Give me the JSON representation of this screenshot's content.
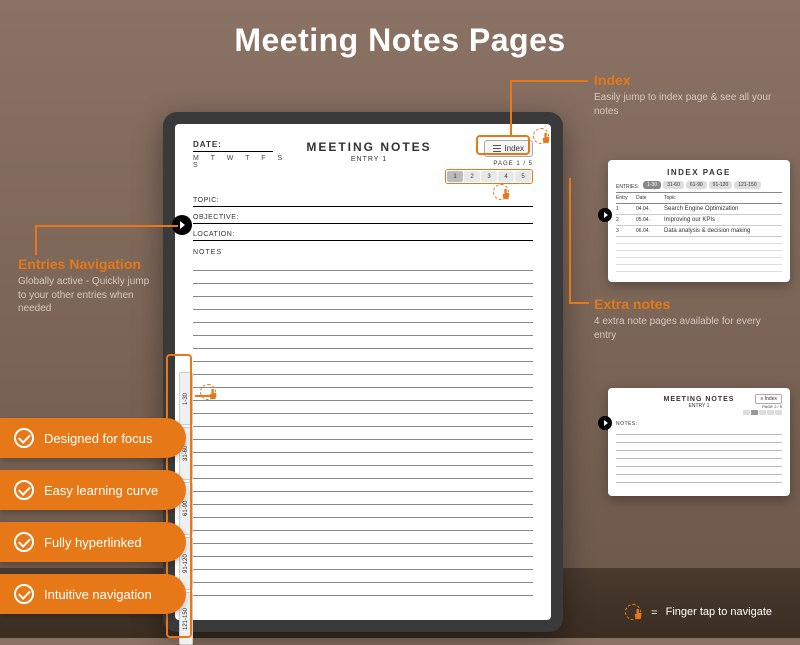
{
  "title": "Meeting Notes Pages",
  "notes": {
    "dateLabel": "DATE:",
    "weekdays": "M  T  W  T  F  S  S",
    "heading": "MEETING NOTES",
    "entry": "ENTRY 1",
    "indexBtn": "Index",
    "pageInfo": "PAGE 1 / 5",
    "pages": [
      "1",
      "2",
      "3",
      "4",
      "5"
    ],
    "fields": {
      "topic": "TOPIC:",
      "objective": "OBJECTIVE:",
      "location": "LOCATION:"
    },
    "notesLabel": "NOTES"
  },
  "sideTabs": [
    "1-30",
    "31-60",
    "61-90",
    "91-120",
    "121-150"
  ],
  "callouts": {
    "index": {
      "title": "Index",
      "text": "Easily jump to index page & see all your notes"
    },
    "extra": {
      "title": "Extra notes",
      "text": "4 extra note pages available for every entry"
    },
    "nav": {
      "title": "Entries Navigation",
      "text": "Globally active - Quickly jump to your other entries when needed"
    }
  },
  "features": [
    "Designed for focus",
    "Easy learning curve",
    "Fully hyperlinked",
    "Intuitive navigation"
  ],
  "indexPreview": {
    "title": "INDEX PAGE",
    "tabs": [
      "1-30",
      "31-60",
      "61-90",
      "91-120",
      "121-150"
    ],
    "entriesLabel": "ENTRIES:",
    "headers": {
      "entry": "Entry",
      "date": "Date",
      "topic": "Topic"
    },
    "rows": [
      {
        "entry": "1",
        "date": "04.04.",
        "topic": "Search Engine Optimization"
      },
      {
        "entry": "2",
        "date": "05.04.",
        "topic": "Improving our KPIs"
      },
      {
        "entry": "3",
        "date": "06.04.",
        "topic": "Data analysis & decision making"
      }
    ]
  },
  "extraPreview": {
    "title": "MEETING NOTES",
    "entry": "ENTRY 1",
    "index": "Index",
    "pageInfo": "PAGE 2 / 5",
    "notesLabel": "NOTES:"
  },
  "tapLegend": {
    "equals": "=",
    "text": "Finger tap to navigate"
  }
}
